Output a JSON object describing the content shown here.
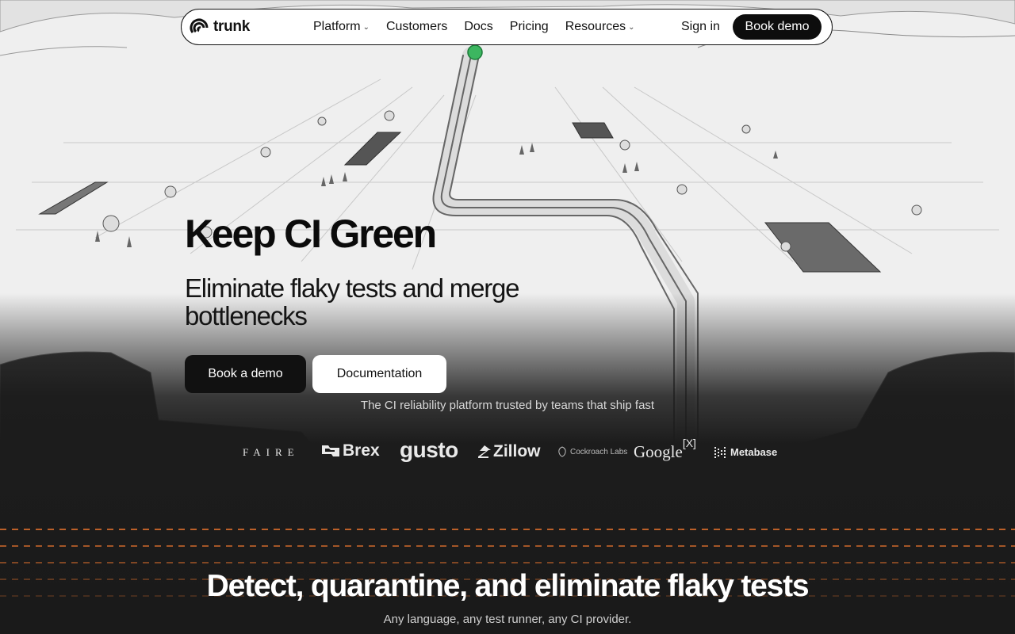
{
  "nav": {
    "brand": "trunk",
    "links": [
      {
        "label": "Platform",
        "has_dropdown": true
      },
      {
        "label": "Customers",
        "has_dropdown": false
      },
      {
        "label": "Docs",
        "has_dropdown": false
      },
      {
        "label": "Pricing",
        "has_dropdown": false
      },
      {
        "label": "Resources",
        "has_dropdown": true
      }
    ],
    "sign_in": "Sign in",
    "book_demo": "Book demo"
  },
  "hero": {
    "title": "Keep CI Green",
    "subtitle": "Eliminate flaky tests and merge bottlenecks",
    "primary_cta": "Book a demo",
    "secondary_cta": "Documentation",
    "trusted_text": "The CI reliability platform trusted by teams that ship fast"
  },
  "logos": {
    "faire": "FAIRE",
    "brex": "Brex",
    "gusto": "gusto",
    "zillow": "Zillow",
    "cockroach": "Cockroach Labs",
    "google": "Google",
    "google_sup": "[X]",
    "metabase": "Metabase"
  },
  "section": {
    "title": "Detect, quarantine, and eliminate flaky tests",
    "subtitle": "Any language, any test runner, any CI provider."
  },
  "colors": {
    "accent_dash": "#c5642a",
    "pipe_end": "#3cb660",
    "dark": "#111111"
  }
}
